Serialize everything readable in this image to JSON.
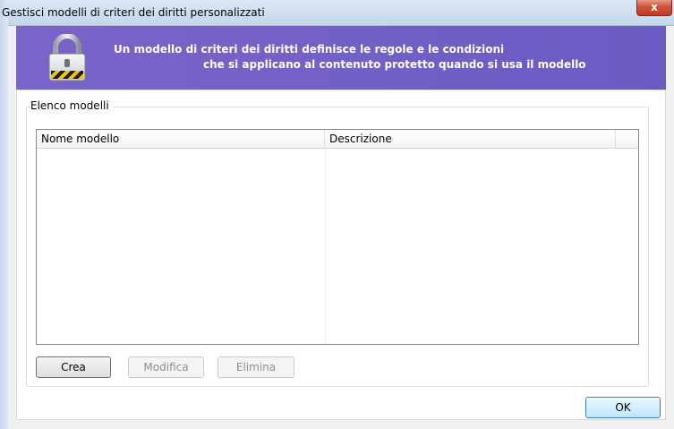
{
  "window": {
    "title": "Gestisci modelli di criteri dei diritti personalizzati",
    "close_label": "x"
  },
  "banner": {
    "line1": "Un modello di criteri dei diritti definisce le regole e le condizioni",
    "line2": "che si applicano al contenuto protetto quando si usa il modello",
    "icon": "padlock-icon",
    "colors": {
      "background": "#7363c6",
      "text": "#ffffff"
    }
  },
  "templates_group": {
    "label": "Elenco modelli",
    "columns": [
      "Nome modello",
      "Descrizione"
    ],
    "rows": []
  },
  "actions": {
    "create": "Crea",
    "edit": "Modifica",
    "delete": "Elimina"
  },
  "footer": {
    "ok": "OK"
  }
}
